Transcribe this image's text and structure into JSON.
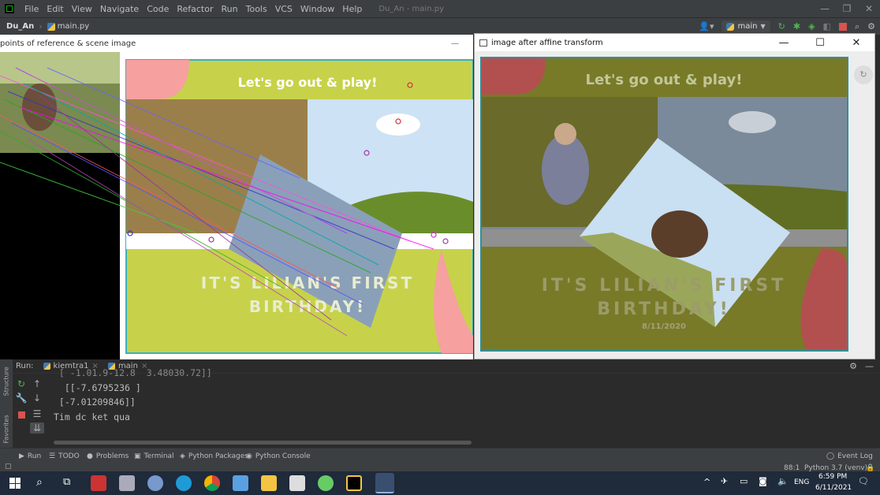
{
  "menu": {
    "items": [
      "File",
      "Edit",
      "View",
      "Navigate",
      "Code",
      "Refactor",
      "Run",
      "Tools",
      "VCS",
      "Window",
      "Help"
    ],
    "project_file": "Du_An - main.py"
  },
  "nav": {
    "project": "Du_An",
    "file": "main.py",
    "branch": "main"
  },
  "window_left": {
    "title": "points of reference & scene image",
    "min_label": "—"
  },
  "window_right": {
    "title": "image after affine transform",
    "min_label": "—",
    "max_label": "☐",
    "close_label": "✕"
  },
  "poster": {
    "headline": "Let's go out & play!",
    "line1": "IT'S LILIAN'S FIRST",
    "line2": "BIRTHDAY!",
    "date": "8/11/2020"
  },
  "run_panel": {
    "label": "Run:",
    "tabs": [
      "kiemtra1",
      "main"
    ],
    "lines": [
      " [ -1.01.9-12.8  3.48030.72]]",
      "  [[-7.6795236 ]",
      " [-7.01209846]]",
      "Tim dc ket qua"
    ]
  },
  "side_labels": {
    "structure": "Structure",
    "favorites": "Favorites"
  },
  "bottom_tabs": [
    "Run",
    "TODO",
    "Problems",
    "Terminal",
    "Python Packages",
    "Python Console"
  ],
  "event_log": "Event Log",
  "status": {
    "position": "88:1",
    "interpreter": "Python 3.7 (venv)"
  },
  "taskbar": {
    "lang": "ENG",
    "time": "6:59 PM",
    "date": "6/11/2021"
  }
}
